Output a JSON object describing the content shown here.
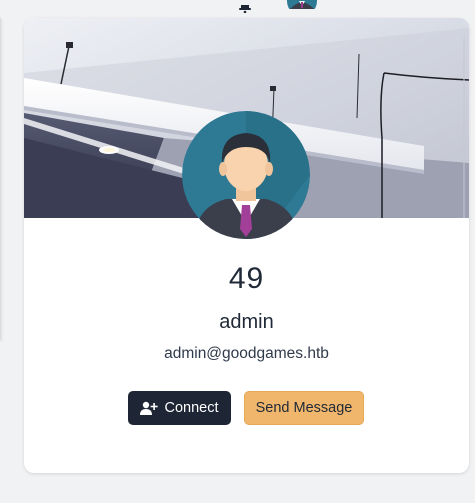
{
  "top_bar": {
    "notification_icon": "bell-icon",
    "user_avatar_icon": "user-avatar-icon"
  },
  "profile": {
    "cover_image": "ceiling-photo",
    "avatar_icon": "businessman-avatar-icon",
    "stat_value": "49",
    "username": "admin",
    "email": "admin@goodgames.htb"
  },
  "actions": {
    "connect_label": "Connect",
    "connect_icon": "user-plus-icon",
    "message_label": "Send Message"
  },
  "colors": {
    "page_background": "#f1f2f4",
    "card_background": "#ffffff",
    "connect_button": "#1e2535",
    "message_button": "#f0b66b",
    "avatar_background": "#2e7a94"
  }
}
